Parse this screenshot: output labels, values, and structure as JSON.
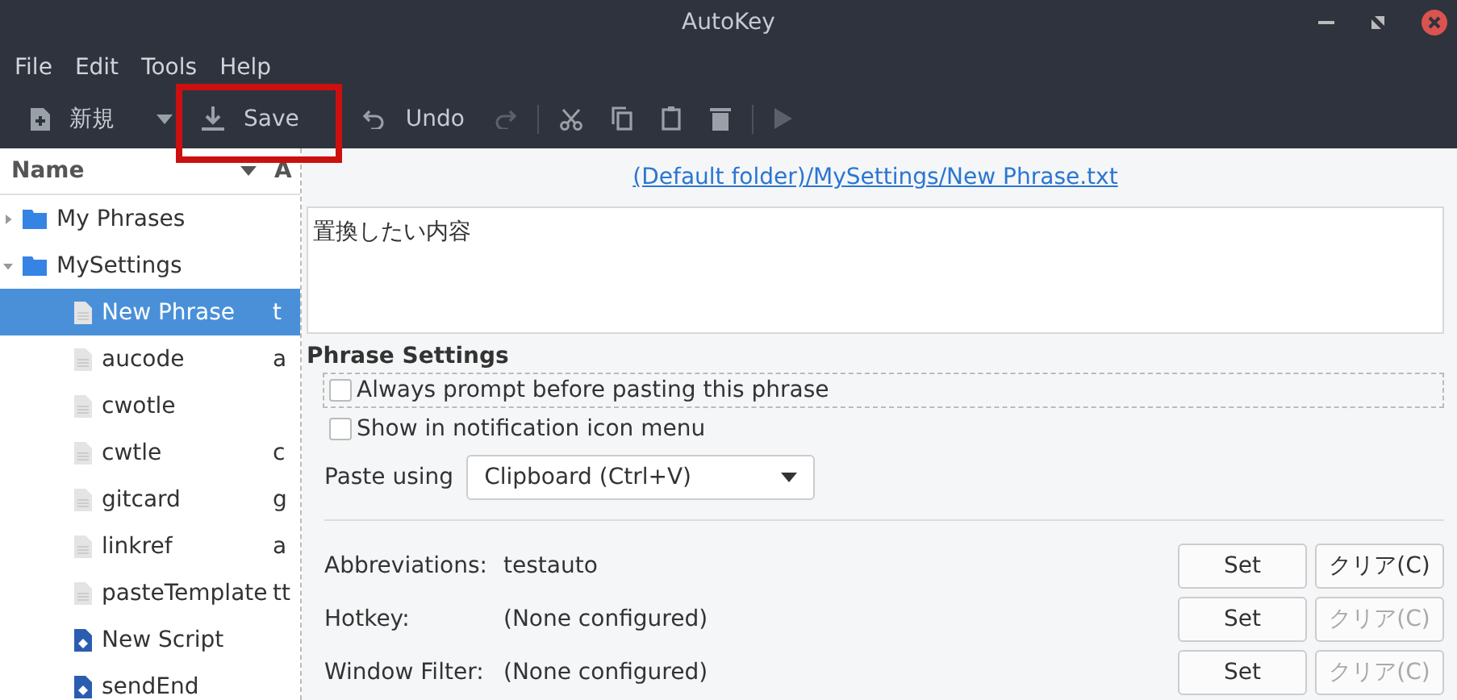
{
  "window": {
    "title": "AutoKey"
  },
  "menu": [
    "File",
    "Edit",
    "Tools",
    "Help"
  ],
  "toolbar": [
    {
      "kind": "new",
      "label": "新規",
      "disabled": false
    },
    {
      "kind": "save",
      "label": "Save",
      "disabled": false
    },
    {
      "kind": "undo",
      "label": "Undo",
      "disabled": false
    },
    {
      "kind": "redo",
      "disabled": true
    },
    {
      "kind": "separator"
    },
    {
      "kind": "cut",
      "disabled": false
    },
    {
      "kind": "copy",
      "disabled": false
    },
    {
      "kind": "paste",
      "disabled": false
    },
    {
      "kind": "delete",
      "disabled": false
    },
    {
      "kind": "separator"
    },
    {
      "kind": "run",
      "disabled": true
    }
  ],
  "tree": {
    "columns": [
      "Name",
      "A"
    ],
    "items": [
      {
        "kind": "folder",
        "name": "My Phrases",
        "expanded": false,
        "selected": false
      },
      {
        "kind": "folder",
        "name": "MySettings",
        "expanded": true,
        "selected": false,
        "children": [
          {
            "kind": "phrase",
            "name": "New Phrase",
            "column_2": "t",
            "selected": true
          },
          {
            "kind": "phrase",
            "name": "aucode",
            "column_2": "a",
            "selected": false
          },
          {
            "kind": "phrase",
            "name": "cwotle",
            "selected": false
          },
          {
            "kind": "phrase",
            "name": "cwtle",
            "column_2": "c",
            "selected": false
          },
          {
            "kind": "phrase",
            "name": "gitcard",
            "column_2": "g",
            "selected": false
          },
          {
            "kind": "phrase",
            "name": "linkref",
            "column_2": "a",
            "selected": false
          },
          {
            "kind": "phrase",
            "name": "pasteTemplate",
            "column_2": "tt",
            "selected": false
          },
          {
            "kind": "script",
            "name": "New Script",
            "selected": false
          },
          {
            "kind": "script",
            "name": "sendEnd",
            "selected": false
          }
        ]
      }
    ]
  },
  "editor": {
    "path": "(Default folder)/MySettings/New Phrase.txt",
    "content": "置換したい内容",
    "settings_title": "Phrase Settings",
    "checkboxes": [
      {
        "label": "Always prompt before pasting this phrase",
        "checked": false,
        "focused": true
      },
      {
        "label": "Show in notification icon menu",
        "checked": false,
        "focused": false
      }
    ],
    "paste_label": "Paste using",
    "paste_value": "Clipboard (Ctrl+V)",
    "rows": [
      {
        "label": "Abbreviations:",
        "value": "testauto",
        "set": "Set",
        "clear": "クリア(C)",
        "clear_disabled": false
      },
      {
        "label": "Hotkey:",
        "value": "(None configured)",
        "set": "Set",
        "clear": "クリア(C)",
        "clear_disabled": true
      },
      {
        "label": "Window Filter:",
        "value": "(None configured)",
        "set": "Set",
        "clear": "クリア(C)",
        "clear_disabled": true
      }
    ]
  }
}
